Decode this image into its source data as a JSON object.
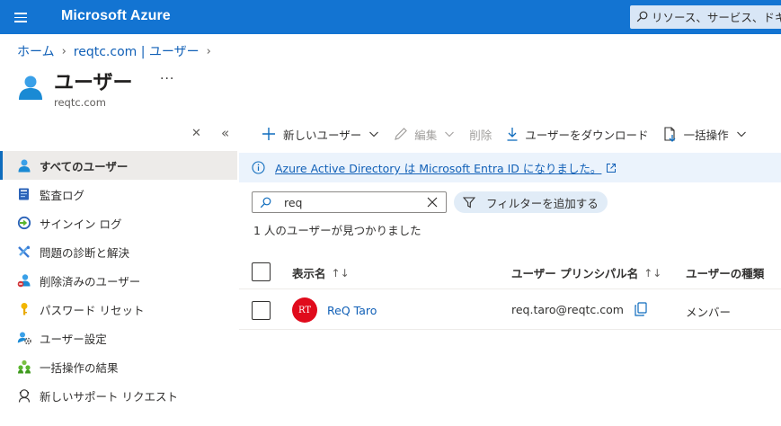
{
  "topbar": {
    "brand": "Microsoft Azure",
    "search_placeholder": "リソース、サービス、ドキュメントの検索"
  },
  "breadcrumb": {
    "items": [
      "ホーム",
      "reqtc.com | ユーザー"
    ]
  },
  "page": {
    "title": "ユーザー",
    "more": "···",
    "subtitle": "reqtc.com"
  },
  "sidebar": {
    "items": [
      {
        "label": "すべてのユーザー",
        "icon": "user-icon",
        "active": true
      },
      {
        "label": "監査ログ",
        "icon": "audit-log-icon"
      },
      {
        "label": "サインイン ログ",
        "icon": "sign-in-log-icon"
      },
      {
        "label": "問題の診断と解決",
        "icon": "wrench-icon"
      },
      {
        "label": "削除済みのユーザー",
        "icon": "deleted-user-icon"
      },
      {
        "label": "パスワード リセット",
        "icon": "key-icon"
      },
      {
        "label": "ユーザー設定",
        "icon": "user-settings-icon"
      },
      {
        "label": "一括操作の結果",
        "icon": "bulk-results-icon"
      },
      {
        "label": "新しいサポート リクエスト",
        "icon": "support-request-icon"
      }
    ]
  },
  "toolbar": {
    "new_user": "新しいユーザー",
    "edit": "編集",
    "delete": "削除",
    "download": "ユーザーをダウンロード",
    "bulk": "一括操作"
  },
  "info": {
    "message": "Azure Active Directory は Microsoft Entra ID になりました。"
  },
  "filter": {
    "value": "req",
    "add_filter": "フィルターを追加する"
  },
  "results": {
    "count_text": "1 人のユーザーが見つかりました"
  },
  "table": {
    "columns": [
      "表示名",
      "ユーザー プリンシパル名",
      "ユーザーの種類"
    ],
    "sort_glyph": "↑↓",
    "rows": [
      {
        "initials": "RT",
        "display_name": "ReQ Taro",
        "upn": "req.taro@reqtc.com",
        "type": "メンバー"
      }
    ]
  },
  "colors": {
    "topbar": "#1374d2",
    "link": "#1160b7",
    "avatar": "#e00b1c",
    "info_bg": "#ebf3fc"
  }
}
